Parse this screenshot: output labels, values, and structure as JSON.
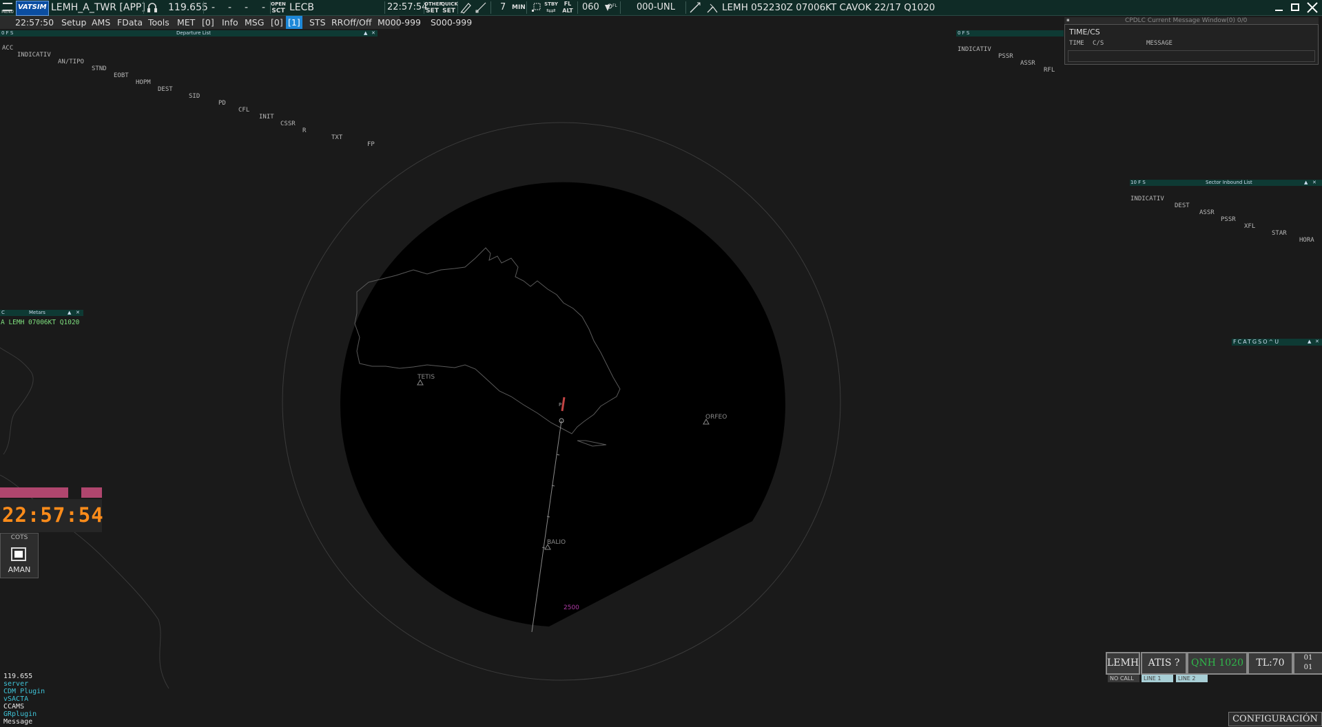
{
  "top_bar": {
    "menu_label": "MENU",
    "logo": "VATSIM",
    "callsign": "LEMH_A_TWR [APP]",
    "frequency": "119.655",
    "dashes": [
      "-",
      "-",
      "-",
      "-"
    ],
    "open_label": "OPEN",
    "sct_label": "SCT",
    "sector": "LECB",
    "clock": "22:57:54",
    "other_label": "OTHER",
    "quick_label": "QUICK",
    "set_label": "SET",
    "range_value": "7",
    "min_label": "MIN",
    "stby_label": "STBY",
    "fl_label": "FL",
    "alt_label": "ALT",
    "fl_value": "060",
    "level_filter": "000-UNL",
    "metar": "LEMH 052230Z 07006KT CAVOK 22/17 Q1020"
  },
  "menu": {
    "time": "22:57:50",
    "items": [
      "Setup",
      "AMS",
      "FData",
      "Tools",
      "MET",
      "[0]",
      "Info",
      "MSG",
      "[0]",
      "[1]",
      "STS",
      "RROff/Off",
      "M000-999",
      "S000-999"
    ],
    "active_index": 9
  },
  "departure_list": {
    "flags": "0 F S",
    "title": "Departure List",
    "columns": [
      "ACC",
      "INDICATIV",
      "AN/TIPO",
      "STND",
      "EOBT",
      "HOPM",
      "DEST",
      "SID",
      "PD",
      "CFL",
      "INIT",
      "CSSR",
      "R",
      "TXT",
      "FP"
    ]
  },
  "arrival_list": {
    "flags": "0 F S",
    "columns": [
      "INDICATIV",
      "PSSR",
      "ASSR",
      "RFL"
    ]
  },
  "cpdlc": {
    "title": "CPDLC Current Message Window(0) 0/0",
    "heading": "TIME/CS",
    "columns": [
      "TIME",
      "C/S",
      "MESSAGE"
    ]
  },
  "sector_inbound": {
    "flags": "10 F S",
    "title": "Sector Inbound List",
    "columns": [
      "INDICATIV",
      "DEST",
      "ASSR",
      "PSSR",
      "XFL",
      "STAR",
      "HORA"
    ]
  },
  "metars_window": {
    "flag": "C",
    "title": "Metars",
    "line": "A LEMH 07006KT Q1020"
  },
  "right_toolbar": {
    "label": "FCATGSO^U"
  },
  "map": {
    "fixes": [
      "TETIS",
      "ORFEO",
      "BALIO"
    ],
    "target_label": "2500"
  },
  "clock_widget": {
    "time": "22:57:54"
  },
  "cots": {
    "label": "COTS",
    "button": "AMAN"
  },
  "plugins": {
    "frequency": "119.655",
    "items": [
      {
        "label": "server",
        "color": "#3fc4d8"
      },
      {
        "label": "CDM Plugin",
        "color": "#3fc4d8"
      },
      {
        "label": "vSACTA",
        "color": "#3fc4d8"
      },
      {
        "label": "CCAMS",
        "color": "#e8e8e8"
      },
      {
        "label": "GRplugin",
        "color": "#3fc4d8"
      },
      {
        "label": "Message",
        "color": "#e8e8e8"
      }
    ]
  },
  "status_strip": {
    "airport": "LEMH",
    "atis": "ATIS ?",
    "qnh": "QNH 1020",
    "tl": "TL:70",
    "counter_top": "01",
    "counter_bottom": "01",
    "no_call": "NO CALL",
    "line1": "LINE 1",
    "line2": "LINE 2"
  },
  "config_button": "CONFIGURACIÓN",
  "colors": {
    "toolbar_bg": "#0f2b26",
    "accent_blue": "#1e88d8",
    "clock_orange": "#ff8c1a",
    "alert_pink": "#b0466e",
    "qnh_green": "#2fb84a",
    "target_purple": "#b03aa6"
  }
}
